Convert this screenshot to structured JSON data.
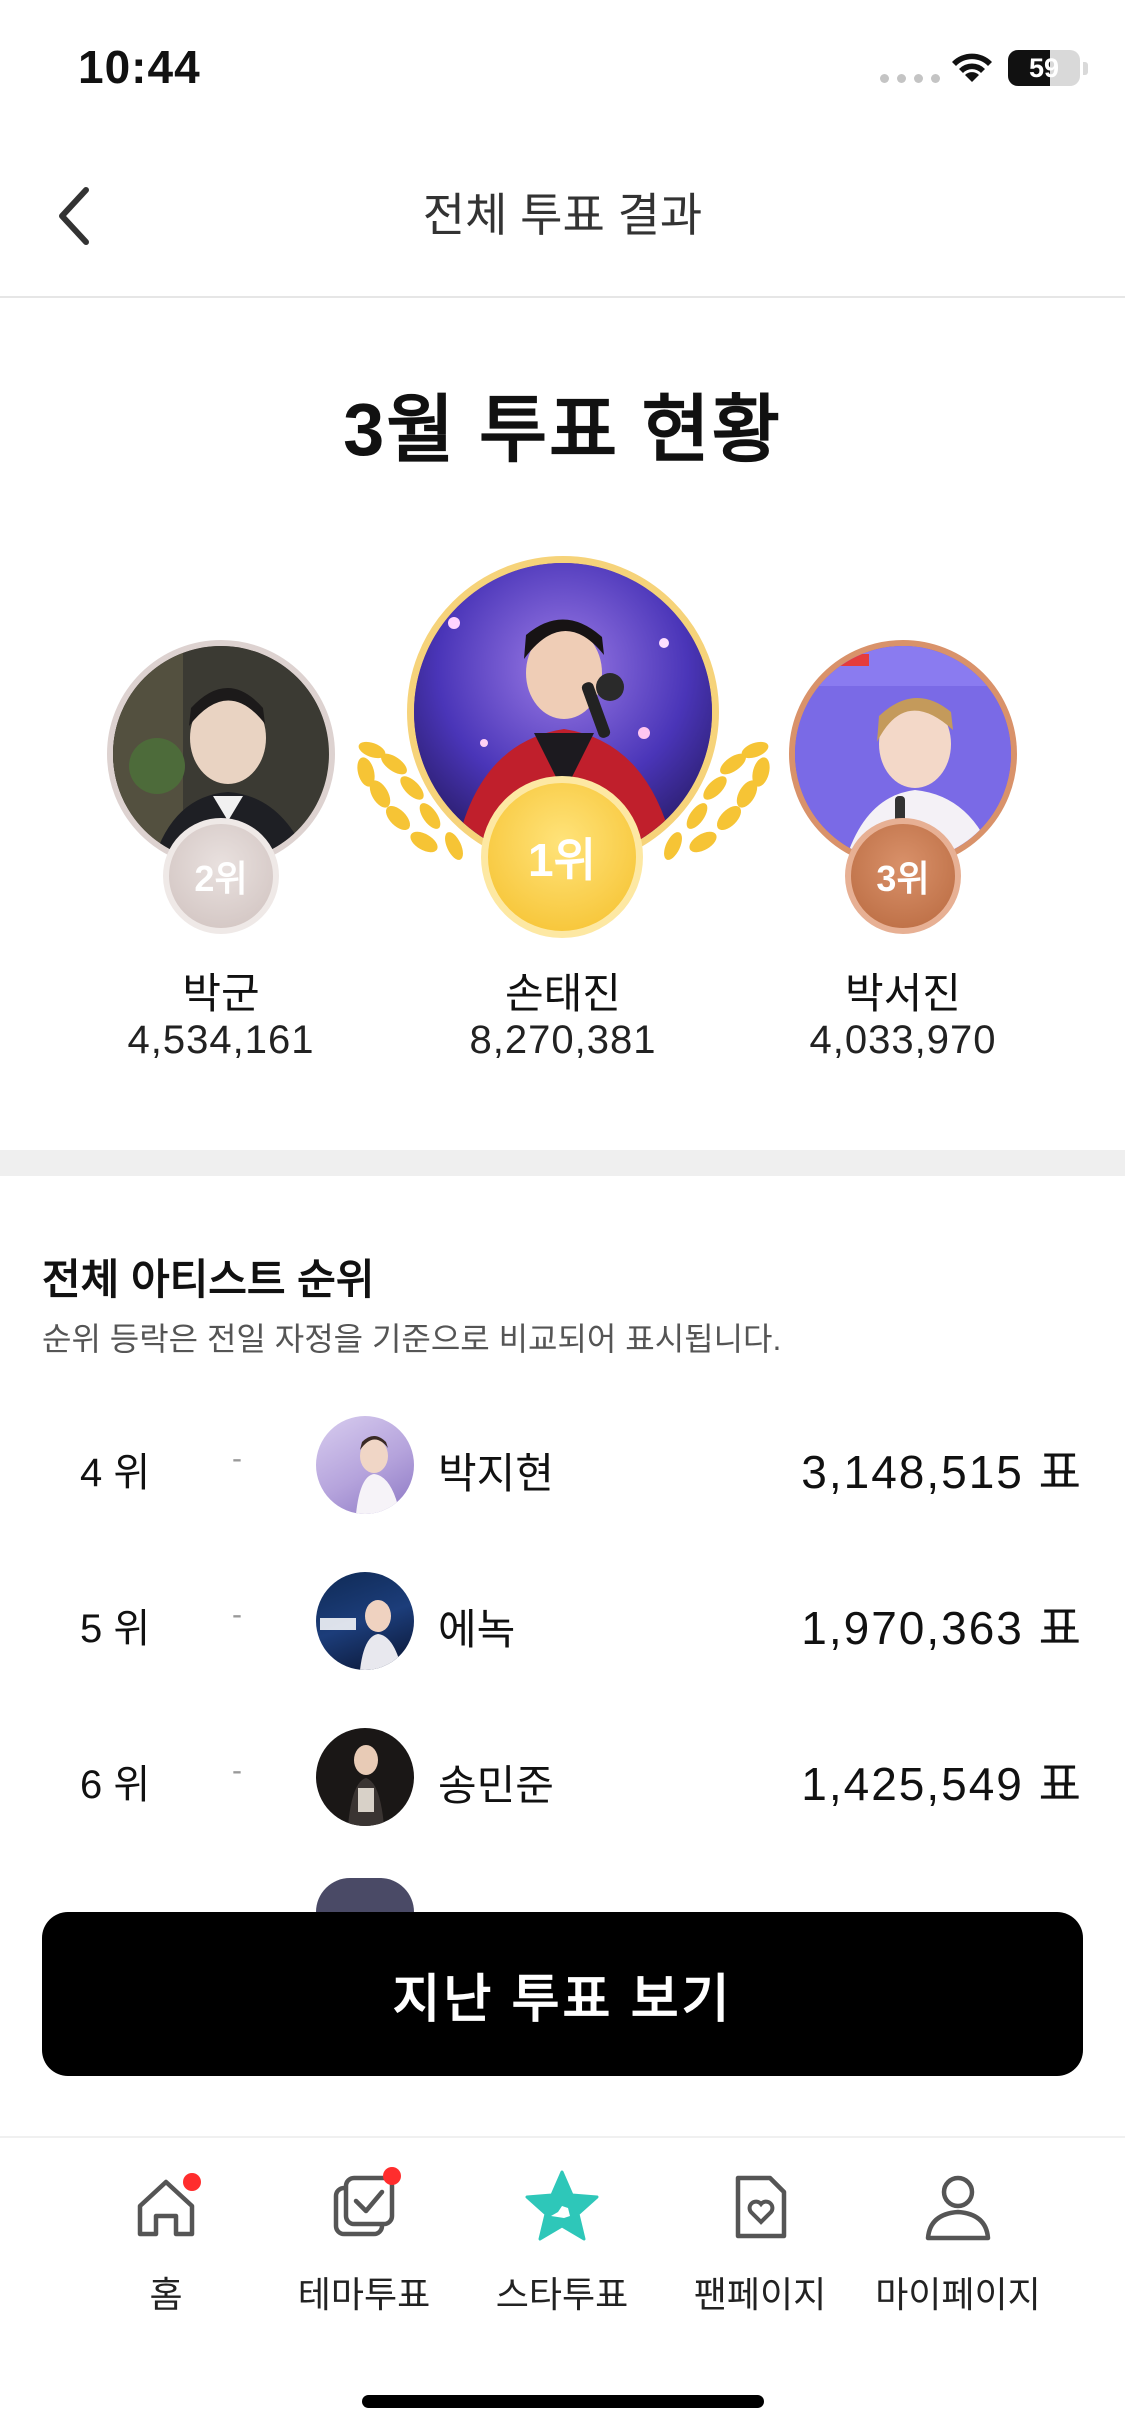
{
  "status_bar": {
    "time": "10:44",
    "battery": "59",
    "battery_level": 0.59
  },
  "header": {
    "title": "전체 투표 결과"
  },
  "podium": {
    "title": "3월 투표 현황",
    "first": {
      "rank_label": "1위",
      "name": "손태진",
      "votes": "8,270,381"
    },
    "second": {
      "rank_label": "2위",
      "name": "박군",
      "votes": "4,534,161"
    },
    "third": {
      "rank_label": "3위",
      "name": "박서진",
      "votes": "4,033,970"
    }
  },
  "ranking": {
    "title": "전체 아티스트 순위",
    "subtitle": "순위 등락은 전일 자정을 기준으로 비교되어 표시됩니다.",
    "rows": [
      {
        "rank": "4 위",
        "change": "-",
        "name": "박지현",
        "votes": "3,148,515 표"
      },
      {
        "rank": "5 위",
        "change": "-",
        "name": "에녹",
        "votes": "1,970,363 표"
      },
      {
        "rank": "6 위",
        "change": "-",
        "name": "송민준",
        "votes": "1,425,549 표"
      }
    ]
  },
  "cta": {
    "label": "지난 투표 보기"
  },
  "tabs": [
    {
      "label": "홈",
      "icon": "home-icon",
      "badge": true
    },
    {
      "label": "테마투표",
      "icon": "theme-vote-icon",
      "badge": true
    },
    {
      "label": "스타투표",
      "icon": "star-vote-icon",
      "active": true
    },
    {
      "label": "팬페이지",
      "icon": "fan-page-icon"
    },
    {
      "label": "마이페이지",
      "icon": "my-page-icon"
    }
  ],
  "colors": {
    "gold": "#f6c435",
    "silver": "#d7ccca",
    "bronze": "#c9805a",
    "tab_active": "#2ec7b9",
    "badge": "#ff2d2d"
  }
}
